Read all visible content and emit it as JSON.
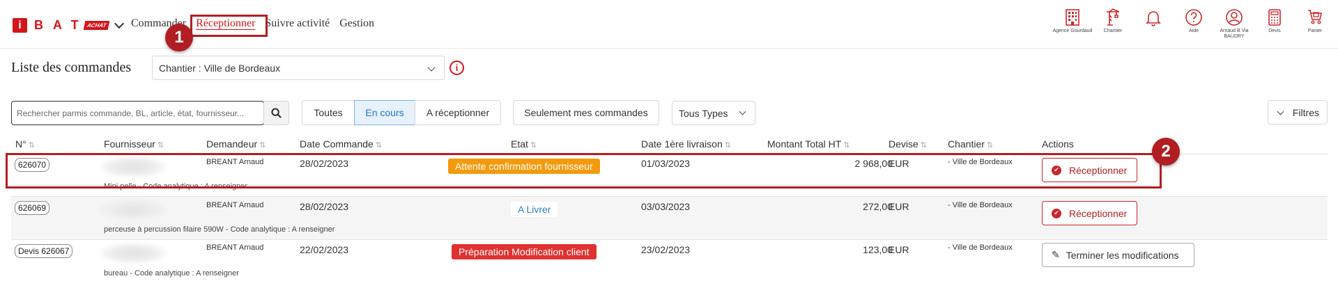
{
  "brand": {
    "logo_letter": "i",
    "name": "BAT",
    "tag": "ACHAT"
  },
  "nav": {
    "items": [
      {
        "label": "Commander"
      },
      {
        "label": "Réceptionner"
      },
      {
        "label": "Suivre activité"
      },
      {
        "label": "Gestion"
      }
    ]
  },
  "callouts": {
    "one": "1",
    "two": "2"
  },
  "header_icons": [
    {
      "icon": "building-icon",
      "label": "Agence Gourdaud"
    },
    {
      "icon": "crane-icon",
      "label": "Chantier"
    },
    {
      "icon": "bell-icon",
      "label": ""
    },
    {
      "icon": "help-icon",
      "label": "Aide"
    },
    {
      "icon": "user-icon",
      "label": "Arnaud B Via BAUDRY"
    },
    {
      "icon": "calculator-icon",
      "label": "Devis"
    },
    {
      "icon": "cart-icon",
      "label": "Panier"
    }
  ],
  "page": {
    "title": "Liste des commandes",
    "chantier_select": "Chantier : Ville de Bordeaux",
    "info_symbol": "i"
  },
  "toolbar": {
    "search_placeholder": "Rechercher parmis commande, BL, article, état, fournisseur...",
    "filters": [
      "Toutes",
      "En cours",
      "A réceptionner"
    ],
    "active_filter": "En cours",
    "mine_button": "Seulement mes commandes",
    "types_select": "Tous Types",
    "filtres_button": "Filtres"
  },
  "table": {
    "columns": [
      "N°",
      "Fournisseur",
      "Demandeur",
      "Date Commande",
      "Etat",
      "Date 1ère livraison",
      "Montant Total HT",
      "Devise",
      "Chantier",
      "Actions"
    ],
    "sort_symbol": "⇅",
    "rows": [
      {
        "num": "626070",
        "description": "Mini pelle - Code analytique : A renseigner",
        "demandeur": "BREANT Arnaud",
        "date_commande": "28/02/2023",
        "etat": "Attente confirmation fournisseur",
        "date_livraison": "01/03/2023",
        "montant": "2 968,00",
        "devise": "EUR",
        "chantier": "- Ville de Bordeaux",
        "action": "Réceptionner"
      },
      {
        "num": "626069",
        "description": "perceuse à percussion filaire 590W - Code analytique : A renseigner",
        "demandeur": "BREANT Arnaud",
        "date_commande": "28/02/2023",
        "etat": "A Livrer",
        "date_livraison": "03/03/2023",
        "montant": "272,00",
        "devise": "EUR",
        "chantier": "- Ville de Bordeaux",
        "action": "Réceptionner"
      },
      {
        "num": "Devis 626067",
        "description": "bureau - Code analytique : A renseigner",
        "demandeur": "BREANT Arnaud",
        "date_commande": "22/02/2023",
        "etat": "Préparation Modification client",
        "date_livraison": "23/02/2023",
        "montant": "123,00",
        "devise": "EUR",
        "chantier": "- Ville de Bordeaux",
        "action": "Terminer les modifications"
      }
    ]
  },
  "colors": {
    "brand_red": "#d3151b",
    "annotation_red": "#b01e23",
    "status_orange": "#f39a0d",
    "status_red": "#e03131",
    "status_blue": "#2f7fc9"
  }
}
